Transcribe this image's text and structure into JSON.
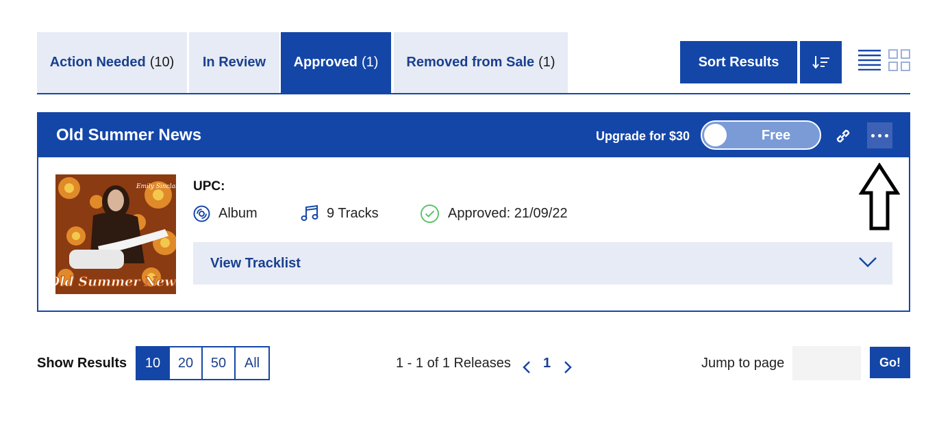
{
  "tabs": [
    {
      "label": "Action Needed",
      "count": "(10)",
      "active": false
    },
    {
      "label": "In Review",
      "count": "",
      "active": false
    },
    {
      "label": "Approved",
      "count": "(1)",
      "active": true
    },
    {
      "label": "Removed from Sale",
      "count": "(1)",
      "active": false
    }
  ],
  "toolbar": {
    "sort_label": "Sort Results",
    "sort_icon": "sort-descending-icon",
    "view_list_icon": "list-view-icon",
    "view_grid_icon": "grid-view-icon"
  },
  "release": {
    "title": "Old Summer News",
    "upgrade_text": "Upgrade for $30",
    "toggle_label": "Free",
    "cover_artist": "Emily Sinclair",
    "cover_title": "Old Summer News",
    "upc_label": "UPC:",
    "type": "Album",
    "tracks": "9 Tracks",
    "status": "Approved: 21/09/22",
    "tracklist_label": "View Tracklist"
  },
  "footer": {
    "show_results_label": "Show Results",
    "page_sizes": [
      "10",
      "20",
      "50",
      "All"
    ],
    "active_page_size": "10",
    "results_count": "1 - 1 of 1 Releases",
    "current_page": "1",
    "jump_label": "Jump to page",
    "jump_value": "",
    "go_label": "Go!"
  },
  "colors": {
    "brand": "#1446a8",
    "tab_bg": "#e6ebf5",
    "approved_green": "#5cc46a"
  }
}
